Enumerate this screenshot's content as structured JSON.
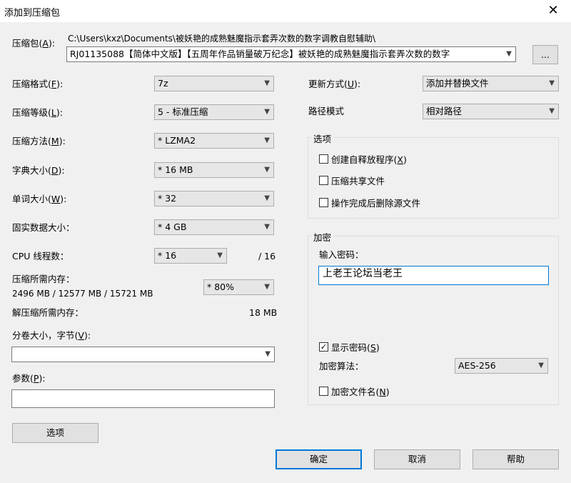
{
  "window": {
    "title": "添加到压缩包",
    "close_glyph": "✕"
  },
  "archive": {
    "label": "压缩包(A):",
    "path": "C:\\Users\\kxz\\Documents\\被妖艳的成熟魅魔指示套弄次数的数字调教自慰辅助\\",
    "name": "RJ01135088【简体中文版】【五周年作品销量破万纪念】被妖艳的成熟魅魔指示套弄次数的数字",
    "browse_label": "..."
  },
  "left": {
    "format": {
      "label": "压缩格式(F):",
      "value": "7z"
    },
    "level": {
      "label": "压缩等级(L):",
      "value": "5 - 标准压缩"
    },
    "method": {
      "label": "压缩方法(M):",
      "value": "* LZMA2"
    },
    "dict": {
      "label": "字典大小(D):",
      "value": "* 16 MB"
    },
    "word": {
      "label": "单词大小(W):",
      "value": "* 32"
    },
    "solid": {
      "label": "固实数据大小：",
      "value": "* 4 GB"
    },
    "cpu": {
      "label": "CPU 线程数：",
      "value": "* 16",
      "max": "/ 16"
    },
    "mem": {
      "label": "压缩所需内存：",
      "detail": "2496 MB / 12577 MB / 15721 MB",
      "value": "* 80%"
    },
    "decomp": {
      "label": "解压缩所需内存：",
      "value": "18 MB"
    },
    "volume": {
      "label": "分卷大小，字节(V):",
      "value": ""
    },
    "params": {
      "label": "参数(P):",
      "value": ""
    },
    "options_button": "选项"
  },
  "right": {
    "update": {
      "label": "更新方式(U):",
      "value": "添加并替换文件"
    },
    "pathmode": {
      "label": "路径模式",
      "value": "相对路径"
    },
    "options": {
      "title": "选项",
      "sfx": {
        "label": "创建自释放程序(X)",
        "checked": false
      },
      "shared": {
        "label": "压缩共享文件",
        "checked": false
      },
      "delete": {
        "label": "操作完成后删除源文件",
        "checked": false
      }
    },
    "encryption": {
      "title": "加密",
      "password_label": "输入密码：",
      "password_value": "上老王论坛当老王",
      "show": {
        "label": "显示密码(S)",
        "checked": true
      },
      "algo_label": "加密算法：",
      "algo_value": "AES-256",
      "encnames": {
        "label": "加密文件名(N)",
        "checked": false
      }
    }
  },
  "footer": {
    "ok": "确定",
    "cancel": "取消",
    "help": "帮助"
  }
}
